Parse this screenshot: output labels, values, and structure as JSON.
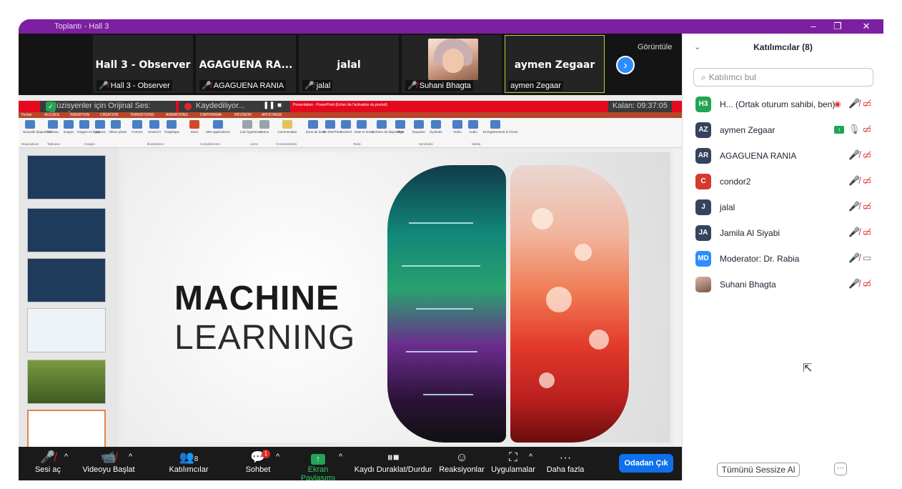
{
  "window": {
    "title": "Toplantı - Hall 3",
    "controls": [
      "–",
      "❐",
      "✕"
    ]
  },
  "video_strip": {
    "tiles": [
      {
        "name": "Hall 3 - Observer",
        "label": "Hall 3 - Observer"
      },
      {
        "name": "AGAGUENA RA...",
        "label": "AGAGUENA RANIA"
      },
      {
        "name": "jalal",
        "label": "jalal"
      },
      {
        "name": "",
        "label": "Suhani Bhagta"
      },
      {
        "name": "aymen Zegaar",
        "label": "aymen Zegaar"
      }
    ],
    "view_label": "Görüntüle",
    "next_icon": "›"
  },
  "share_bar": {
    "audio_label": "Müzisyenler için Orijinal Ses: Kapalı",
    "recording_label": "Kaydediliyor...",
    "pp_title": "Presentation - PowerPoint (Échec de l'activation du produit)",
    "remaining": "Kalan: 09:37:05"
  },
  "ppt": {
    "tabs": [
      "Fichier",
      "ACCUEIL",
      "INSERTION",
      "CRÉATION",
      "TRANSITIONS",
      "ANIMATIONS",
      "DIAPORAMA",
      "RÉVISION",
      "AFFICHAGE"
    ],
    "ribbon_buttons": [
      "Nouvelle diapositive",
      "Tableau",
      "Images",
      "Images en ligne",
      "Capture",
      "Album photo",
      "Formes",
      "SmartArt",
      "Graphique",
      "Store",
      "Mes applications",
      "Lien hypertexte",
      "Action",
      "Commentaire",
      "Zone de texte",
      "En-tête/Pied",
      "WordArt",
      "Date et heure",
      "Numéro de diapositive",
      "Objet",
      "Équation",
      "Symbole",
      "Vidéo",
      "Audio",
      "Enregistrement à l'écran"
    ],
    "ribbon_groups": [
      "Diapositives",
      "Tableaux",
      "Images",
      "Illustrations",
      "Compléments",
      "Liens",
      "Commentaires",
      "Texte",
      "Symboles",
      "Média"
    ],
    "thumb_numbers": [
      "3",
      "4",
      "5",
      "6",
      "7",
      "8"
    ],
    "slide_title_line1": "MACHINE",
    "slide_title_line2": "LEARNING"
  },
  "toolbar": {
    "items": [
      {
        "label": "Sesi aç",
        "icon": "microphone-muted-icon"
      },
      {
        "label": "Videoyu Başlat",
        "icon": "video-off-icon"
      },
      {
        "label": "Katılımcılar",
        "icon": "participants-icon",
        "count": "8"
      },
      {
        "label": "Sohbet",
        "icon": "chat-icon",
        "badge": "1"
      },
      {
        "label": "Ekran Paylaşımı",
        "icon": "share-screen-icon"
      },
      {
        "label": "Kaydı Duraklat/Durdur",
        "icon": "pause-stop-icon"
      },
      {
        "label": "Reaksiyonlar",
        "icon": "reactions-icon"
      },
      {
        "label": "Uygulamalar",
        "icon": "apps-icon"
      },
      {
        "label": "Daha fazla",
        "icon": "more-icon"
      }
    ],
    "leave_label": "Odadan Çık"
  },
  "panel": {
    "title": "Katılımcılar (8)",
    "search_placeholder": "Katılımcı bul",
    "participants": [
      {
        "initials": "H3",
        "name": "H... (Ortak oturum sahibi, ben)",
        "color": "#23a455",
        "recording": true,
        "audio": "muted",
        "video": "off"
      },
      {
        "initials": "AZ",
        "name": "aymen Zegaar",
        "color": "#35435f",
        "sharing": true,
        "audio": "on",
        "video": "off"
      },
      {
        "initials": "AR",
        "name": "AGAGUENA RANIA",
        "color": "#35435f",
        "audio": "muted",
        "video": "off"
      },
      {
        "initials": "C",
        "name": "condor2",
        "color": "#d63a2b",
        "audio": "muted",
        "video": "off"
      },
      {
        "initials": "J",
        "name": "jalal",
        "color": "#35435f",
        "audio": "muted",
        "video": "off"
      },
      {
        "initials": "JA",
        "name": "Jamila Al Siyabi",
        "color": "#35435f",
        "audio": "muted",
        "video": "off"
      },
      {
        "initials": "MD",
        "name": "Moderator: Dr. Rabia",
        "color": "#2d8cff",
        "audio": "muted",
        "video": "on"
      },
      {
        "initials": "",
        "name": "Suhani Bhagta",
        "color": "photo",
        "audio": "muted",
        "video": "off"
      }
    ],
    "mute_all_label": "Tümünü Sessize Al",
    "more_label": "···"
  }
}
